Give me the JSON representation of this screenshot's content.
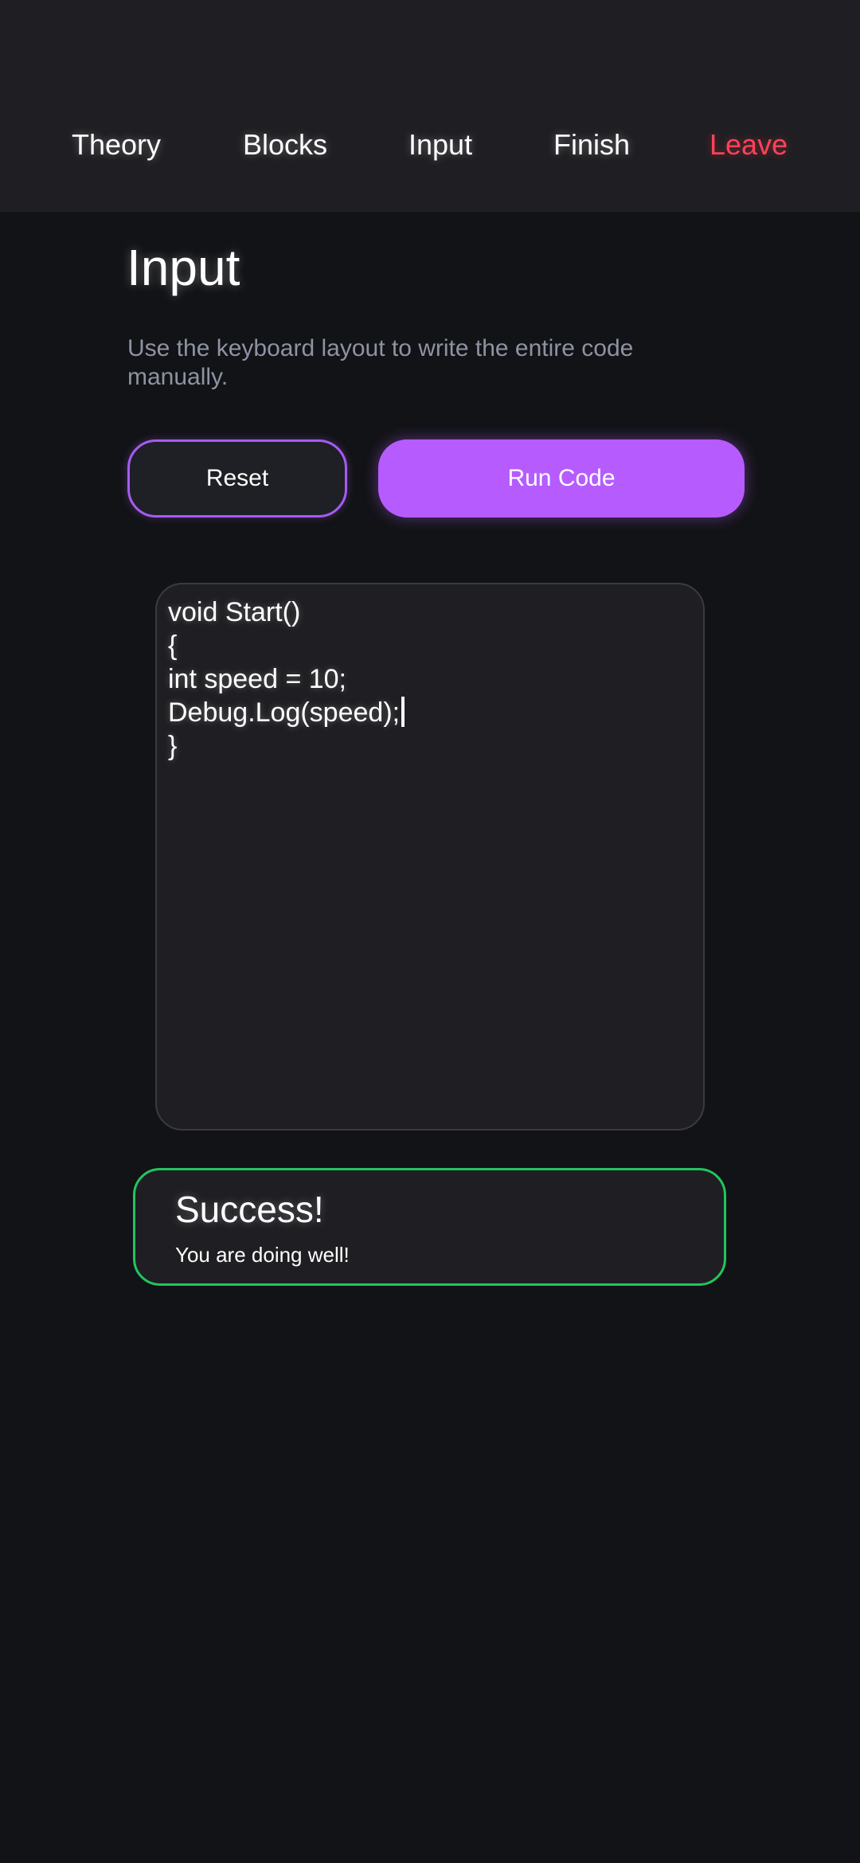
{
  "nav": {
    "items": [
      {
        "label": "Theory"
      },
      {
        "label": "Blocks"
      },
      {
        "label": "Input"
      },
      {
        "label": "Finish"
      },
      {
        "label": "Leave"
      }
    ]
  },
  "page": {
    "title": "Input",
    "description": "Use the keyboard layout to write the entire code manually."
  },
  "actions": {
    "reset_label": "Reset",
    "run_label": "Run Code"
  },
  "editor": {
    "lines": [
      "void Start()",
      "{",
      "int speed = 10;",
      "Debug.Log(speed);",
      "}"
    ]
  },
  "result": {
    "title": "Success!",
    "message": "You are doing well!"
  },
  "colors": {
    "accent": "#b65cff",
    "danger": "#ff4257",
    "success": "#22c55e",
    "background": "#121316"
  }
}
